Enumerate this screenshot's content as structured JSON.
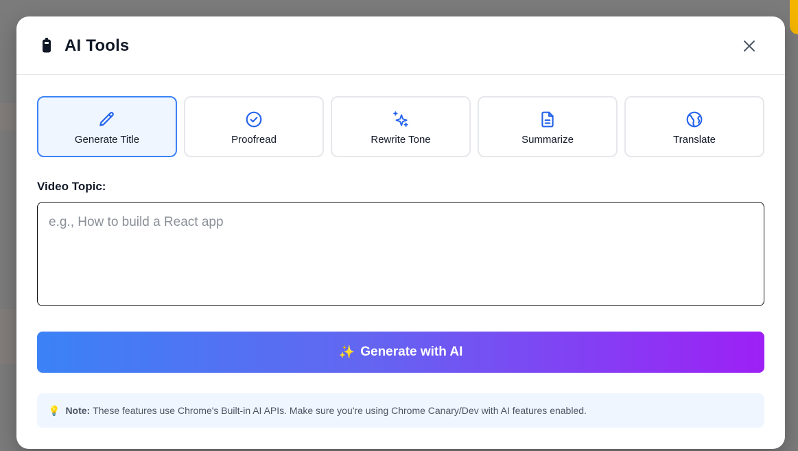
{
  "modal": {
    "title": "AI Tools",
    "title_icon": "battery-icon",
    "close_icon": "close-icon"
  },
  "tabs": [
    {
      "label": "Generate Title",
      "icon": "pencil-icon",
      "active": true
    },
    {
      "label": "Proofread",
      "icon": "check-circle-icon",
      "active": false
    },
    {
      "label": "Rewrite Tone",
      "icon": "sparkles-icon",
      "active": false
    },
    {
      "label": "Summarize",
      "icon": "document-icon",
      "active": false
    },
    {
      "label": "Translate",
      "icon": "globe-icon",
      "active": false
    }
  ],
  "form": {
    "label": "Video Topic:",
    "placeholder": "e.g., How to build a React app",
    "value": ""
  },
  "action": {
    "emoji": "✨",
    "label": "Generate with AI"
  },
  "note": {
    "emoji": "💡",
    "label": "Note:",
    "text": "These features use Chrome's Built-in AI APIs. Make sure you're using Chrome Canary/Dev with AI features enabled."
  },
  "colors": {
    "accent": "#3b82f6",
    "active_tab_bg": "#eff6ff",
    "gradient_start": "#3b82f6",
    "gradient_end": "#9d20f5",
    "note_bg": "#eff6ff"
  }
}
